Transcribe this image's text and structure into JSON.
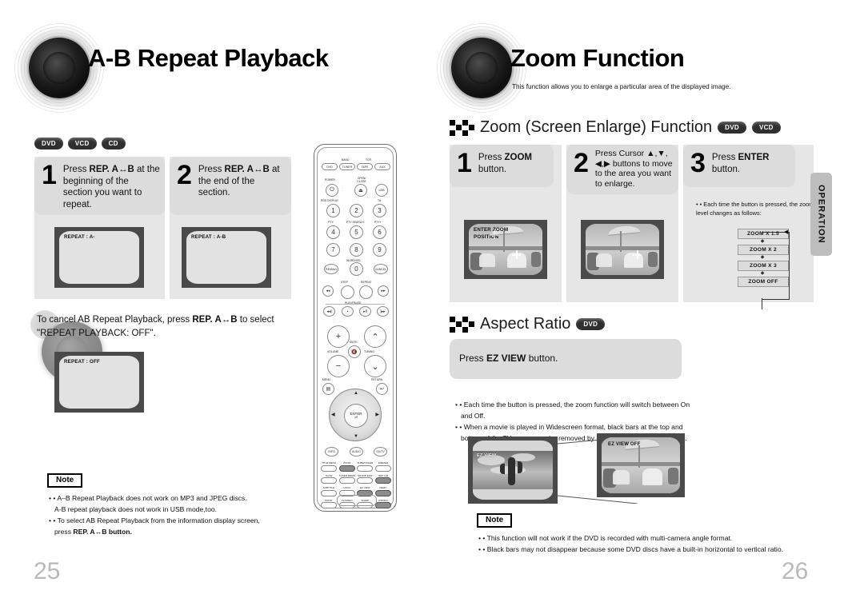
{
  "document": {
    "type": "dvd-player-user-manual-spread",
    "left_page_number": "25",
    "right_page_number": "26",
    "side_tab_label": "OPERATION"
  },
  "left_page": {
    "title": "A-B Repeat Playback",
    "disc_badges": [
      "DVD",
      "VCD",
      "CD"
    ],
    "steps": [
      {
        "number": "1",
        "text_html": "Press <b>REP. A↔B</b> at the beginning of the section you want to repeat.",
        "tv_osd": "REPEAT : A-"
      },
      {
        "number": "2",
        "text_html": "Press <b>REP. A↔B</b> at the end of the section.",
        "tv_osd": "REPEAT : A-B"
      }
    ],
    "cancel_note_html": "To cancel AB Repeat Playback, press <b>REP. A↔B</b> to select \"REPEAT PLAYBACK: OFF\".",
    "cancel_tv_osd": "REPEAT : OFF",
    "note": {
      "label": "Note",
      "bullets": [
        {
          "bullet": true,
          "text_html": "A–B Repeat Playback does not work on MP3 and JPEG discs."
        },
        {
          "bullet": false,
          "text_html": "A-B repeat playback does not work in USB mode,too."
        },
        {
          "bullet": true,
          "text_html": "To select AB Repeat Playback from the information display screen,"
        },
        {
          "bullet": false,
          "text_html": "press <b>REP. A↔B button.</b>"
        }
      ]
    }
  },
  "right_page": {
    "title": "Zoom Function",
    "subtitle": "This function allows you to enlarge a particular area of the displayed image.",
    "sections": [
      {
        "heading": "Zoom (Screen Enlarge) Function",
        "disc_badges": [
          "DVD",
          "VCD"
        ],
        "steps": [
          {
            "number": "1",
            "text_html": "Press <b>ZOOM</b> button.",
            "tv_osd": "ENTER ZOOM\nPOSITION"
          },
          {
            "number": "2",
            "text_html": "Press Cursor ▲,▼, ◀,▶ buttons to move to the area you want to enlarge.",
            "tv_osd": ""
          },
          {
            "number": "3",
            "text_html": "Press <b>ENTER</b> button.",
            "tv_osd": ""
          }
        ],
        "zoom_note_html": "Each time the button is pressed, the zoom level changes as follows:",
        "zoom_levels": [
          "ZOOM X 1.5",
          "ZOOM X 2",
          "ZOOM X 3",
          "ZOOM OFF"
        ]
      },
      {
        "heading": "Aspect Ratio",
        "disc_badges": [
          "DVD"
        ],
        "instruction_html": "Press <b>EZ VIEW</b> button.",
        "bullets": [
          {
            "bullet": true,
            "text_html": "Each time the button is pressed, the zoom function will switch between On"
          },
          {
            "bullet": false,
            "text_html": "and Off."
          },
          {
            "bullet": true,
            "text_html": "When a movie is played in Widescreen format, black bars at the top and"
          },
          {
            "bullet": false,
            "text_html": "bottom of the TV screen can be removed by pressing the <b>EZ VIEW</b> button."
          }
        ],
        "tv_left_osd": "EZ VIEW",
        "tv_right_osd": "EZ VIEW OFF"
      }
    ],
    "note": {
      "label": "Note",
      "bullets": [
        {
          "bullet": true,
          "text_html": "This function will not work if the DVD is recorded with multi-camera angle format."
        },
        {
          "bullet": true,
          "text_html": "Black bars may not disappear because some DVD discs have a built-in horizontal to vertical ratio."
        }
      ]
    }
  },
  "remote": {
    "band_label": "BAND",
    "band_sub": "TCR",
    "source_keys": [
      "DVD",
      "TUNER",
      "TAPE",
      "AUX"
    ],
    "power_label": "POWER",
    "openclose_label": "OPEN/\nCLOSE",
    "usb_label": "USB",
    "rds_label": "RDS DISPLAY",
    "ta_label": "TA",
    "numbers": [
      "1",
      "2",
      "3",
      "4",
      "5",
      "6",
      "7",
      "8",
      "9",
      "0"
    ],
    "pty_labels": [
      "PTY-",
      "PTY SEARCH",
      "PTY+"
    ],
    "word_sel_label": "WORD/SEL",
    "remain_label": "REMAIN",
    "cancel_label": "CANCEL",
    "step_label": "STEP",
    "repeat_label": "REPEAT",
    "play_pause_label": "PLAY/PAUSE",
    "volume_label": "VOLUME",
    "mute_label": "MUTE",
    "tuning_label": "TUNING",
    "menu_label": "MENU",
    "return_label": "RETURN",
    "enter_label": "ENTER",
    "info_label": "INFO",
    "audio_label": "AUDIO",
    "sd_tv_label": "SD/TV",
    "bottom_keys": [
      [
        "TITLE MENU",
        "ZOOM",
        "SUBWOOFER",
        "DIMMER"
      ],
      [
        "SLOW",
        "TUNER MEMORY",
        "SOUND EDIT",
        "REP A-B"
      ],
      [
        "SUBTITLE",
        "LOGO",
        "EZ VIEW",
        "DEMO"
      ],
      [
        "MO/ST",
        "TV/VIDEO",
        "SLEEP",
        "DSP/EQ"
      ]
    ],
    "highlighted_keys": [
      "ZOOM",
      "EZ VIEW",
      "REP A-B",
      "DSP/EQ",
      "DEMO"
    ]
  }
}
